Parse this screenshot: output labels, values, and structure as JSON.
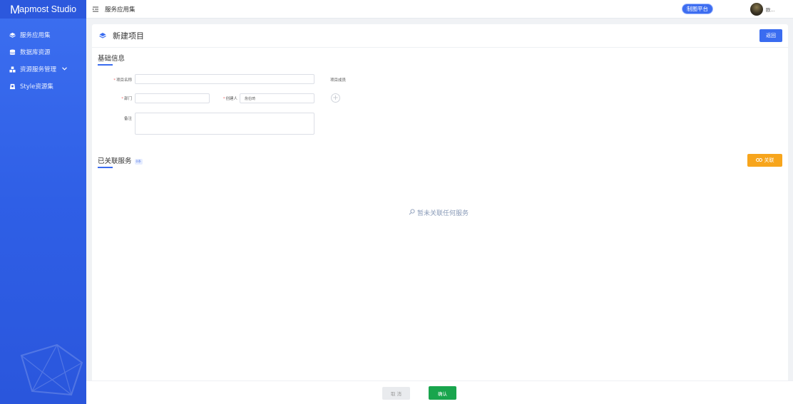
{
  "brand": {
    "logo_letter": "M",
    "name_rest": "apmost Studio"
  },
  "sidebar": {
    "items": [
      {
        "label": "服务应用集",
        "icon": "layers-icon"
      },
      {
        "label": "数据库资源",
        "icon": "database-icon"
      },
      {
        "label": "资源服务管理",
        "icon": "cubes-icon",
        "expandable": true
      },
      {
        "label": "Style资源集",
        "icon": "style-icon"
      }
    ]
  },
  "topbar": {
    "breadcrumb": "服务应用集",
    "platform_button": "制图平台",
    "username": "欧..."
  },
  "card": {
    "title": "新建项目",
    "back_button": "返回"
  },
  "basic_info": {
    "section_title": "基础信息",
    "fields": {
      "project_name": {
        "label": "项目名称",
        "required": true,
        "value": ""
      },
      "project_members": {
        "label": "项目成员"
      },
      "department": {
        "label": "部门",
        "required": true,
        "value": ""
      },
      "creator": {
        "label": "创建人",
        "required": true,
        "value": "詹伯琦"
      },
      "remarks": {
        "label": "备注",
        "value": ""
      }
    }
  },
  "linked_services": {
    "section_title": "已关联服务",
    "count_badge": "0条",
    "link_button": "关联",
    "empty_text": "暂未关联任何服务"
  },
  "footer": {
    "cancel_button": "取 消",
    "confirm_button": "确认"
  },
  "colors": {
    "sidebar": "#2f5fe6",
    "primary": "#3a6cf0",
    "warning": "#f7a51c",
    "success": "#19a54d"
  }
}
